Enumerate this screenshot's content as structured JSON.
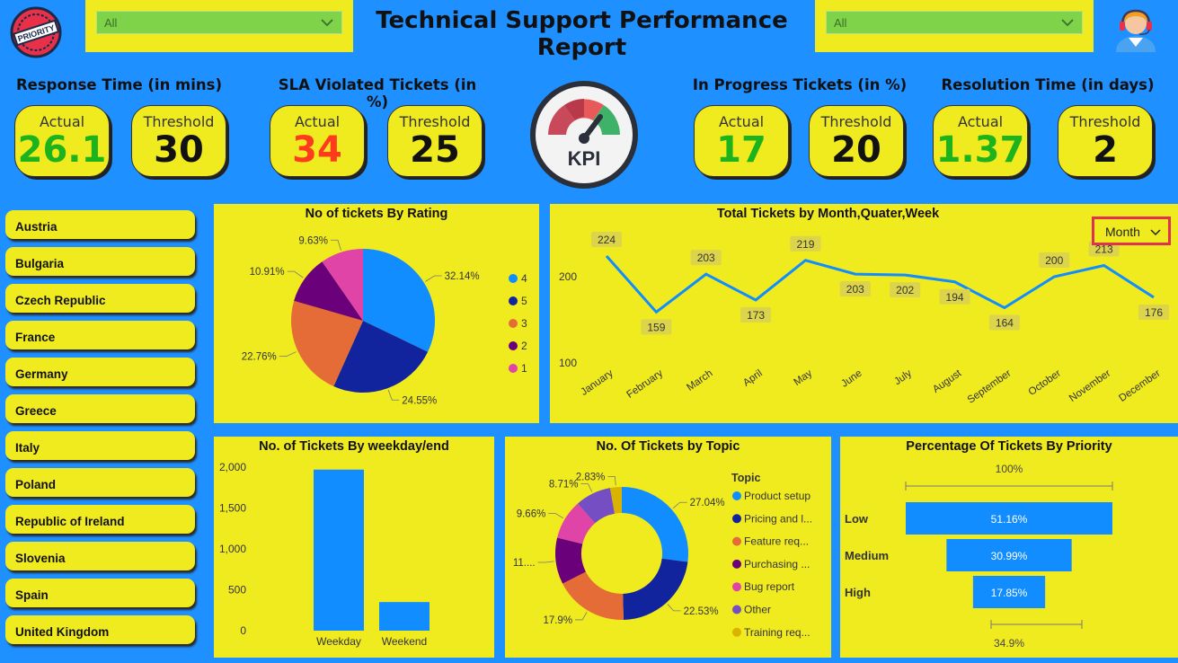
{
  "header": {
    "title": "Technical Support Performance Report",
    "logo_text": "PRIORITY",
    "slicer_left": "All",
    "slicer_right": "All",
    "gauge_text": "KPI"
  },
  "kpis": [
    {
      "label": "Response Time (in mins)",
      "actual_label": "Actual",
      "actual": "26.1",
      "actual_color": "#1db31d",
      "threshold_label": "Threshold",
      "threshold": "30"
    },
    {
      "label": "SLA Violated Tickets (in %)",
      "actual_label": "Actual",
      "actual": "34",
      "actual_color": "#ff3b1f",
      "threshold_label": "Threshold",
      "threshold": "25"
    },
    {
      "label": "In Progress Tickets (in %)",
      "actual_label": "Actual",
      "actual": "17",
      "actual_color": "#1db31d",
      "threshold_label": "Threshold",
      "threshold": "20"
    },
    {
      "label": "Resolution Time (in days)",
      "actual_label": "Actual",
      "actual": "1.37",
      "actual_color": "#1db31d",
      "threshold_label": "Threshold",
      "threshold": "2"
    }
  ],
  "countries": [
    "Austria",
    "Bulgaria",
    "Czech Republic",
    "France",
    "Germany",
    "Greece",
    "Italy",
    "Poland",
    "Republic of Ireland",
    "Slovenia",
    "Spain",
    "United Kingdom"
  ],
  "month_button": "Month",
  "chart_data": [
    {
      "type": "pie",
      "title": "No of tickets By Rating",
      "categories": [
        "4",
        "5",
        "3",
        "2",
        "1"
      ],
      "values": [
        32.14,
        24.55,
        22.76,
        10.91,
        9.63
      ],
      "labels": [
        "32.14%",
        "24.55%",
        "22.76%",
        "10.91%",
        "9.63%"
      ],
      "colors": [
        "#118dff",
        "#12239e",
        "#e66c37",
        "#6b007b",
        "#e044a7"
      ],
      "legend": "right"
    },
    {
      "type": "line",
      "title": "Total Tickets by Month,Quater,Week",
      "categories": [
        "January",
        "February",
        "March",
        "April",
        "May",
        "June",
        "July",
        "August",
        "September",
        "October",
        "November",
        "December"
      ],
      "values": [
        224,
        159,
        203,
        173,
        219,
        203,
        202,
        194,
        164,
        200,
        213,
        176
      ],
      "yticks": [
        100,
        200
      ],
      "ylim": [
        100,
        240
      ],
      "color": "#118dff"
    },
    {
      "type": "bar",
      "title": "No. of Tickets By weekday/end",
      "categories": [
        "Weekday",
        "Weekend"
      ],
      "values": [
        1970,
        350
      ],
      "yticks": [
        "0",
        "500",
        "1,000",
        "1,500",
        "2,000"
      ],
      "ylim": [
        0,
        2000
      ],
      "color": "#118dff"
    },
    {
      "type": "pie",
      "title": "No. Of Tickets by Topic",
      "legend_title": "Topic",
      "categories": [
        "Product setup",
        "Pricing and l...",
        "Feature req...",
        "Purchasing ...",
        "Bug report",
        "Other",
        "Training req..."
      ],
      "values": [
        27.04,
        22.53,
        17.9,
        11.3,
        9.66,
        8.71,
        2.83
      ],
      "labels": [
        "27.04%",
        "22.53%",
        "17.9%",
        "11....",
        "9.66%",
        "8.71%",
        "2.83%"
      ],
      "colors": [
        "#118dff",
        "#12239e",
        "#e66c37",
        "#6b007b",
        "#e044a7",
        "#744ec2",
        "#d9b300"
      ],
      "legend": "right"
    },
    {
      "type": "bar",
      "title": "Percentage Of Tickets By Priority",
      "categories": [
        "Low",
        "Medium",
        "High"
      ],
      "values": [
        51.16,
        30.99,
        17.85
      ],
      "labels": [
        "51.16%",
        "30.99%",
        "17.85%"
      ],
      "top_label": "100%",
      "bottom_label": "34.9%",
      "color": "#118dff"
    }
  ]
}
